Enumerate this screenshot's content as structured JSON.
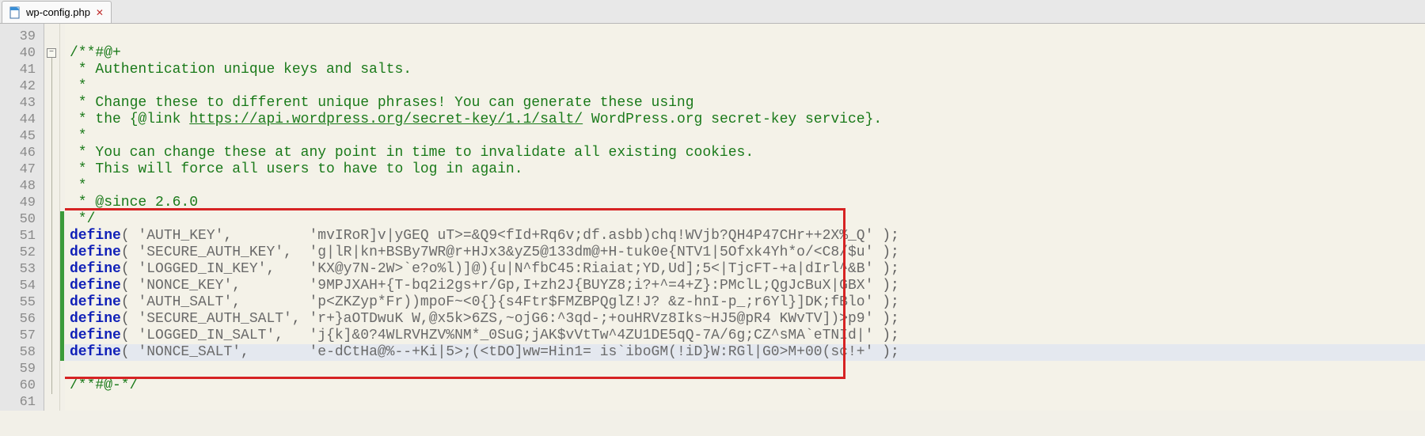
{
  "tab": {
    "filename": "wp-config.php"
  },
  "gutter": {
    "start": 39,
    "end": 61
  },
  "fold": {
    "minus_at_line": 40
  },
  "change_marks": [
    {
      "from": 50,
      "to": 58
    }
  ],
  "highlight_box": {
    "from_line": 50,
    "to_line": 59
  },
  "current_line": 58,
  "code": {
    "39": {
      "type": "blank"
    },
    "40": {
      "type": "comment",
      "text": "/**#@+"
    },
    "41": {
      "type": "comment",
      "text": " * Authentication unique keys and salts."
    },
    "42": {
      "type": "comment",
      "text": " *"
    },
    "43": {
      "type": "comment",
      "text": " * Change these to different unique phrases! You can generate these using"
    },
    "44": {
      "type": "comment_link",
      "pre": " * the {@link ",
      "link": "https://api.wordpress.org/secret-key/1.1/salt/",
      "post": " WordPress.org secret-key service}."
    },
    "45": {
      "type": "comment",
      "text": " *"
    },
    "46": {
      "type": "comment",
      "text": " * You can change these at any point in time to invalidate all existing cookies."
    },
    "47": {
      "type": "comment",
      "text": " * This will force all users to have to log in again."
    },
    "48": {
      "type": "comment",
      "text": " *"
    },
    "49": {
      "type": "comment",
      "text": " * @since 2.6.0"
    },
    "50": {
      "type": "comment",
      "text": " */"
    },
    "51": {
      "type": "define",
      "key": "'AUTH_KEY'",
      "pad": "        ",
      "val": "'mvIRoR]v|yGEQ uT>=&Q9<fId+Rq6v;df.asbb)chq!WVjb?QH4P47CHr++2X%_Q'"
    },
    "52": {
      "type": "define",
      "key": "'SECURE_AUTH_KEY'",
      "pad": " ",
      "val": "'g|lR|kn+BSBy7WR@r+HJx3&yZ5@133dm@+H-tuk0e{NTV1|5Ofxk4Yh*o/<C8/$u'"
    },
    "53": {
      "type": "define",
      "key": "'LOGGED_IN_KEY'",
      "pad": "   ",
      "val": "'KX@y7N-2W>`e?o%l)]@){u|N^fbC45:Riaiat;YD,Ud];5<|TjcFT-+a|dIrl^&B'"
    },
    "54": {
      "type": "define",
      "key": "'NONCE_KEY'",
      "pad": "       ",
      "val": "'9MPJXAH+{T-bq2i2gs+r/Gp,I+zh2J{BUYZ8;i?+^=4+Z}:PMclL;QgJcBuX|GBX'"
    },
    "55": {
      "type": "define",
      "key": "'AUTH_SALT'",
      "pad": "       ",
      "val": "'p<ZKZyp*Fr))mpoF~<0{}{s4Ftr$FMZBPQglZ!J? &z-hnI-p_;r6Yl}]DK;fBlo'"
    },
    "56": {
      "type": "define",
      "key": "'SECURE_AUTH_SALT'",
      "pad": "",
      "val": "'r+}aOTDwuK W,@x5k>6ZS,~ojG6:^3qd-;+ouHRVz8Iks~HJ5@pR4 KWvTV])>p9'"
    },
    "57": {
      "type": "define",
      "key": "'LOGGED_IN_SALT'",
      "pad": "  ",
      "val": "'j{k]&0?4WLRVHZV%NM*_0SuG;jAK$vVtTw^4ZU1DE5qQ-7A/6g;CZ^sMA`eTNId|'"
    },
    "58": {
      "type": "define",
      "key": "'NONCE_SALT'",
      "pad": "      ",
      "val": "'e-dCtHa@%--+Ki|5>;(<tDO]ww=Hin1= is`iboGM(!iD}W:RGl|G0>M+00(sc!+'"
    },
    "59": {
      "type": "blank"
    },
    "60": {
      "type": "comment",
      "text": "/**#@-*/"
    },
    "61": {
      "type": "blank"
    }
  }
}
